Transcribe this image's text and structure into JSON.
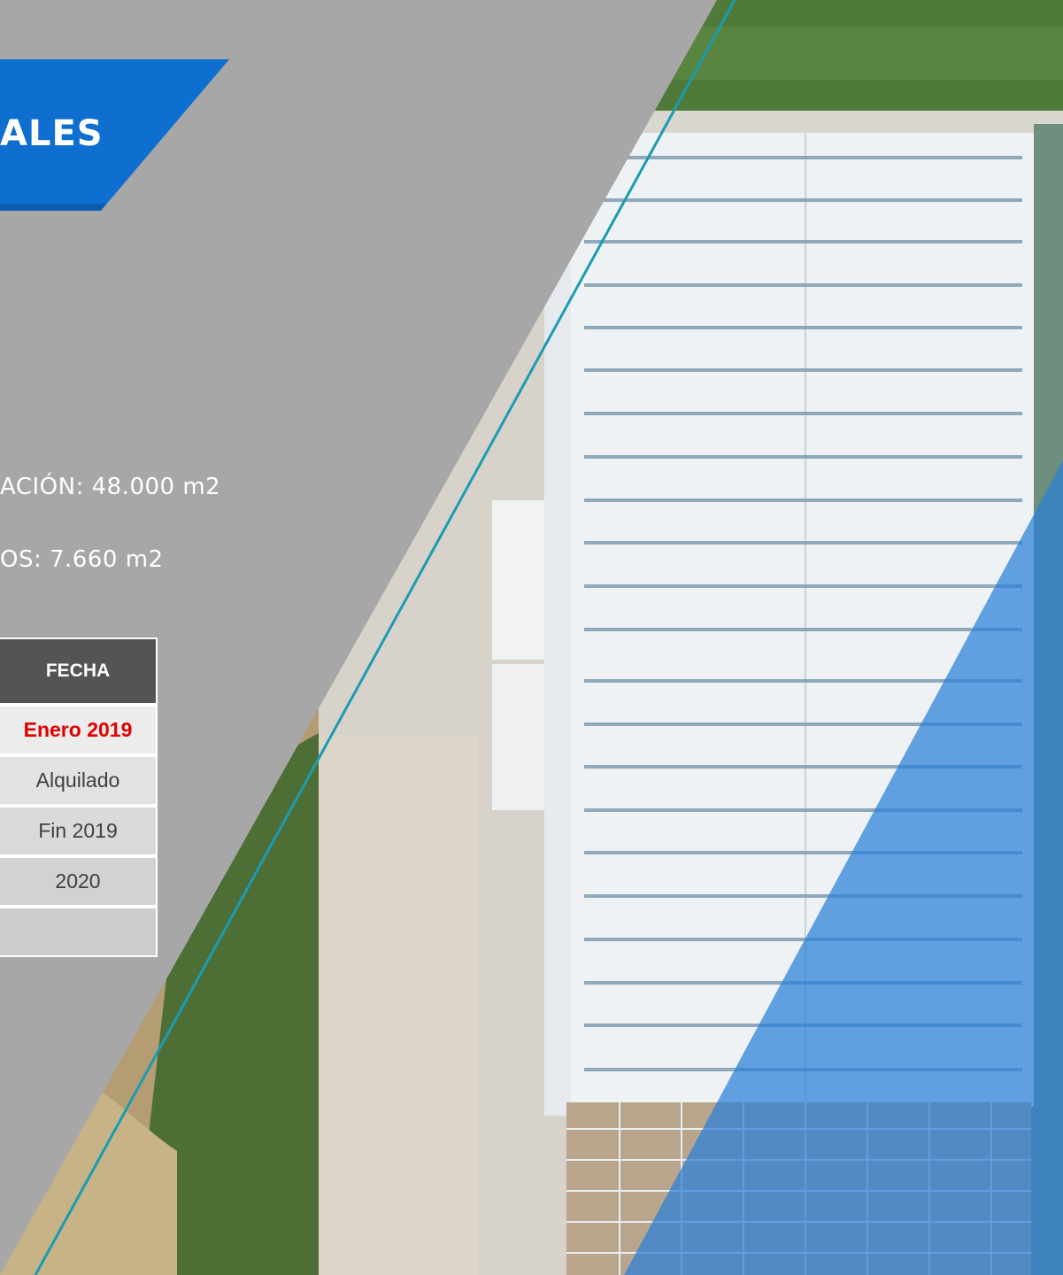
{
  "banner": {
    "title": "ALES"
  },
  "info": {
    "line1": "ACIÓN: 48.000 m2",
    "line2": "OS: 7.660 m2"
  },
  "table": {
    "header": "FECHA",
    "rows": [
      "Enero 2019",
      "Alquilado",
      "Fin 2019",
      "2020",
      ""
    ]
  },
  "colors": {
    "gray_panel": "#a7a7a7",
    "banner_blue": "#0e6fd0",
    "accent_line": "#1a9cb3",
    "overlay_blue": "#2a7fd8",
    "highlight_red": "#e10000"
  }
}
